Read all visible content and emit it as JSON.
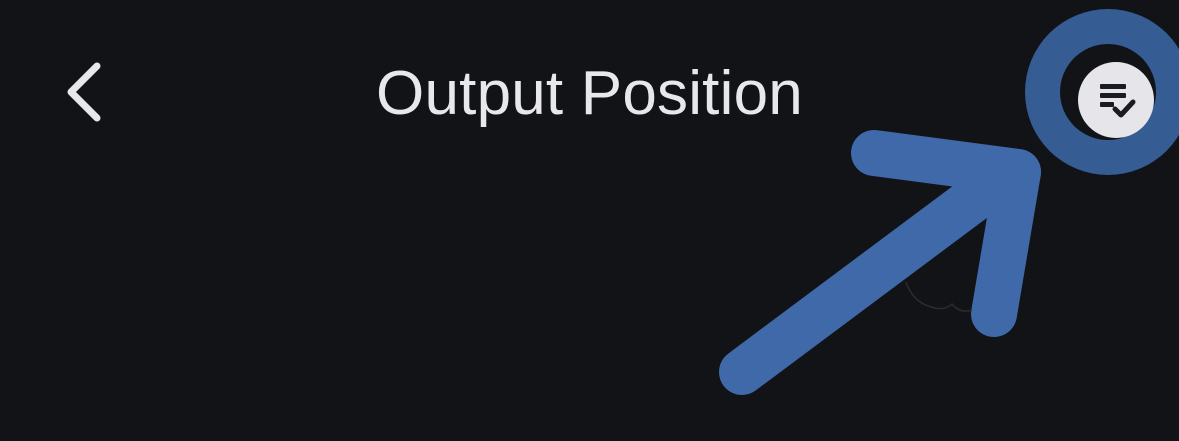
{
  "header": {
    "title": "Output Position",
    "back_icon": "chevron-left-icon",
    "apply_icon": "list-check-icon"
  },
  "annotation": {
    "type": "arrow-highlight",
    "color": "#3f69a8"
  }
}
